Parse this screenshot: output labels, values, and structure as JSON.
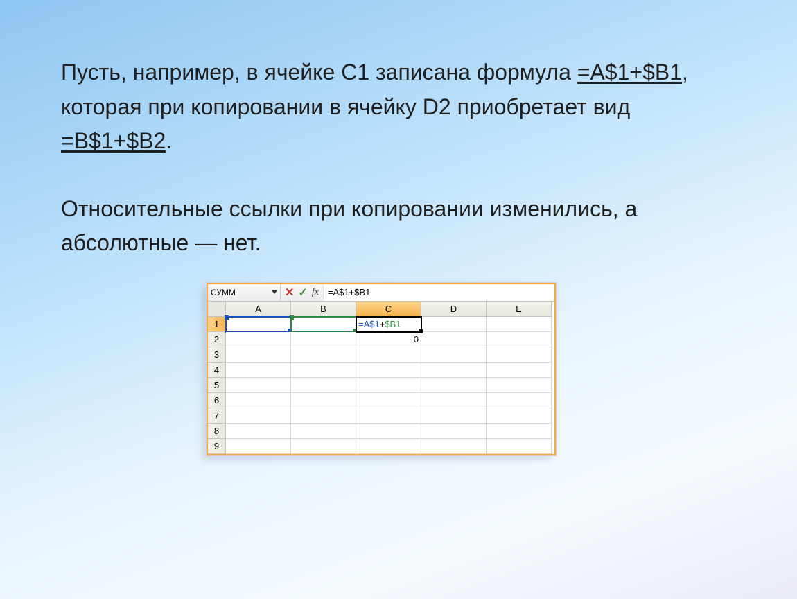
{
  "text": {
    "p1_a": "Пусть, например, в ячейке C1 записана формула ",
    "p1_f1": "=A$1+$B1",
    "p1_b": ", которая при копировании в ячейку D2 приобретает вид ",
    "p1_f2": "=B$1+$B2",
    "p1_c": ".",
    "p2": "Относительные ссылки при копировании изменились, а абсолютные — нет."
  },
  "excel": {
    "name_box": "СУММ",
    "fx_label": "fx",
    "formula_bar": "=A$1+$B1",
    "columns": [
      "A",
      "B",
      "C",
      "D",
      "E"
    ],
    "rows": [
      "1",
      "2",
      "3",
      "4",
      "5",
      "6",
      "7",
      "8",
      "9"
    ],
    "cell_c1_tok1": "=A$1",
    "cell_c1_op": "+",
    "cell_c1_tok2": "$B1",
    "cell_c2": "0"
  }
}
